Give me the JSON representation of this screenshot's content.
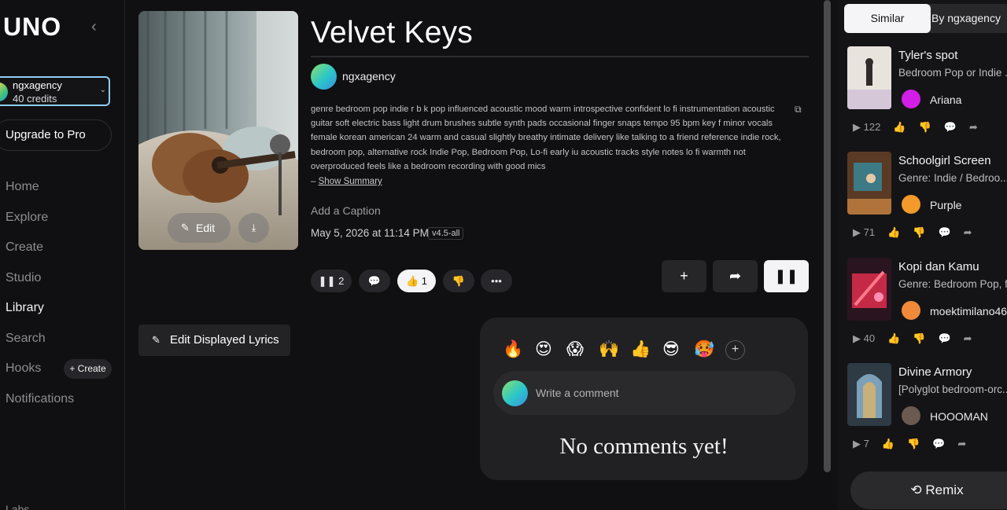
{
  "sidebar": {
    "logo": "UNO",
    "account_name": "ngxagency",
    "account_credits": "40 credits",
    "upgrade_label": "Upgrade to Pro",
    "nav": [
      "Home",
      "Explore",
      "Create",
      "Studio",
      "Library",
      "Search",
      "Hooks",
      "Notifications"
    ],
    "active_nav": "Library",
    "hooks_create_label": "+ Create",
    "cut_text": "Labs"
  },
  "track": {
    "title": "Velvet Keys",
    "artist": "ngxagency",
    "description": "genre bedroom pop indie r b k pop influenced acoustic mood warm introspective confident lo fi instrumentation acoustic guitar soft electric bass light drum brushes subtle synth pads occasional finger snaps tempo 95 bpm key f minor vocals female korean american 24 warm and casual slightly breathy intimate delivery like talking to a friend reference indie rock, bedroom pop, alternative rock Indie Pop, Bedroom Pop, Lo-fi early iu acoustic tracks style notes lo fi warmth not overproduced feels like a bedroom recording with good mics",
    "summary_prefix": "–",
    "summary_link": "Show Summary",
    "caption_placeholder": "Add a Caption",
    "date": "May 5, 2026 at 11:14 PM",
    "version": "v4.5-all",
    "cover_edit_label": "Edit",
    "plays": "2",
    "likes": "1"
  },
  "lyrics_button": "Edit Displayed Lyrics",
  "comments": {
    "emojis": [
      "🔥",
      "😍",
      "😱",
      "🙌",
      "👍",
      "😎",
      "🥵"
    ],
    "placeholder": "Write a comment",
    "empty_text": "No comments yet!"
  },
  "right_panel": {
    "tabs": [
      "Similar",
      "By ngxagency"
    ],
    "songs": [
      {
        "title": "Tyler's spot",
        "genre": "Bedroom Pop or Indie ...",
        "user": "Ariana",
        "plays": "122",
        "avatar_color": "#d21ee6"
      },
      {
        "title": "Schoolgirl Screen",
        "genre": "Genre: Indie / Bedroo...",
        "user": "Purple",
        "plays": "71",
        "avatar_color": "#f39a2a"
      },
      {
        "title": "Kopi dan Kamu",
        "genre": "Genre: Bedroom Pop, f",
        "user": "moektimilano46",
        "plays": "40",
        "avatar_color": "#f08a3a"
      },
      {
        "title": "Divine Armory",
        "genre": "[Polyglot bedroom-orc...",
        "user": "HOOOMAN",
        "plays": "7",
        "avatar_color": "#6a5a52"
      }
    ],
    "remix_label": "Remix"
  }
}
